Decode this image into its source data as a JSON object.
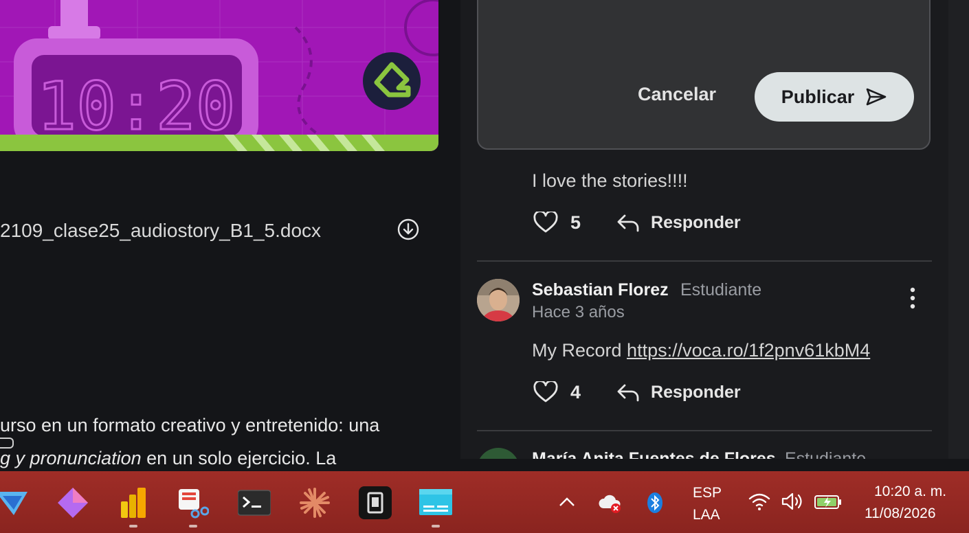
{
  "banner": {
    "clock_text": "10:20"
  },
  "attachment": {
    "file_name": "2109_clase25_audiostory_B1_5.docx"
  },
  "description": {
    "line1": "urso en un formato creativo y entretenido: una",
    "line2_italic": "pronunciation",
    "line2_rest": " en un solo ejercicio. La",
    "line2_prefix": "g y "
  },
  "compose": {
    "cancel_label": "Cancelar",
    "publish_label": "Publicar"
  },
  "comments": [
    {
      "text": "I love the stories!!!!",
      "likes": "5",
      "reply_label": "Responder"
    },
    {
      "author": "Sebastian Florez",
      "role": "Estudiante",
      "time": "Hace 3 años",
      "text_prefix": "My Record ",
      "link": "https://voca.ro/1f2pnv61kbM4",
      "likes": "4",
      "reply_label": "Responder"
    },
    {
      "author": "María Anita Fuentes de Flores",
      "role": "Estudiante"
    }
  ],
  "taskbar": {
    "language": "ESP",
    "layout": "LAA",
    "time": "10:20 a. m.",
    "date": "11/08/2026"
  },
  "colors": {
    "banner": "#a117b6",
    "banner_stripe": "#8bc53f",
    "publish_bg": "#dde3e4",
    "taskbar": "#9f2d27"
  }
}
